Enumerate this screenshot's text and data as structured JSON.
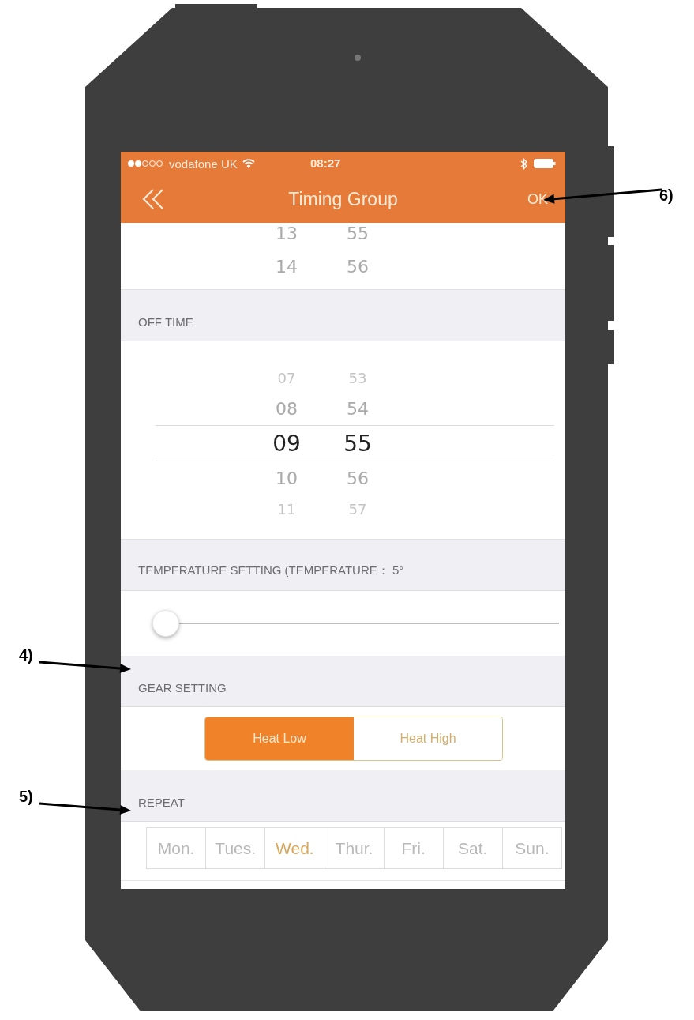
{
  "status_bar": {
    "carrier": "vodafone UK",
    "time": "08:27"
  },
  "nav_bar": {
    "title": "Timing Group",
    "ok": "OK"
  },
  "on_time_picker": {
    "rows": [
      {
        "hour": "13",
        "minute": "55",
        "selected": false
      },
      {
        "hour": "14",
        "minute": "56",
        "selected": false
      }
    ]
  },
  "off_time": {
    "header": "OFF TIME",
    "rows": [
      {
        "hour": "07",
        "minute": "53",
        "selected": false
      },
      {
        "hour": "08",
        "minute": "54",
        "selected": false
      },
      {
        "hour": "09",
        "minute": "55",
        "selected": true
      },
      {
        "hour": "10",
        "minute": "56",
        "selected": false
      },
      {
        "hour": "11",
        "minute": "57",
        "selected": false
      }
    ]
  },
  "temperature": {
    "header": "TEMPERATURE SETTING (TEMPERATURE： 5°",
    "level": 0
  },
  "gear": {
    "header": "GEAR SETTING",
    "options": [
      {
        "label": "Heat Low",
        "selected": true
      },
      {
        "label": "Heat High",
        "selected": false
      }
    ]
  },
  "repeat": {
    "header": "REPEAT",
    "days": [
      {
        "label": "Mon.",
        "selected": false
      },
      {
        "label": "Tues.",
        "selected": false
      },
      {
        "label": "Wed.",
        "selected": true
      },
      {
        "label": "Thur.",
        "selected": false
      },
      {
        "label": "Fri.",
        "selected": false
      },
      {
        "label": "Sat.",
        "selected": false
      },
      {
        "label": "Sun.",
        "selected": false
      }
    ]
  },
  "annotations": [
    {
      "label": "6)"
    },
    {
      "label": "4)"
    },
    {
      "label": "5)"
    }
  ]
}
